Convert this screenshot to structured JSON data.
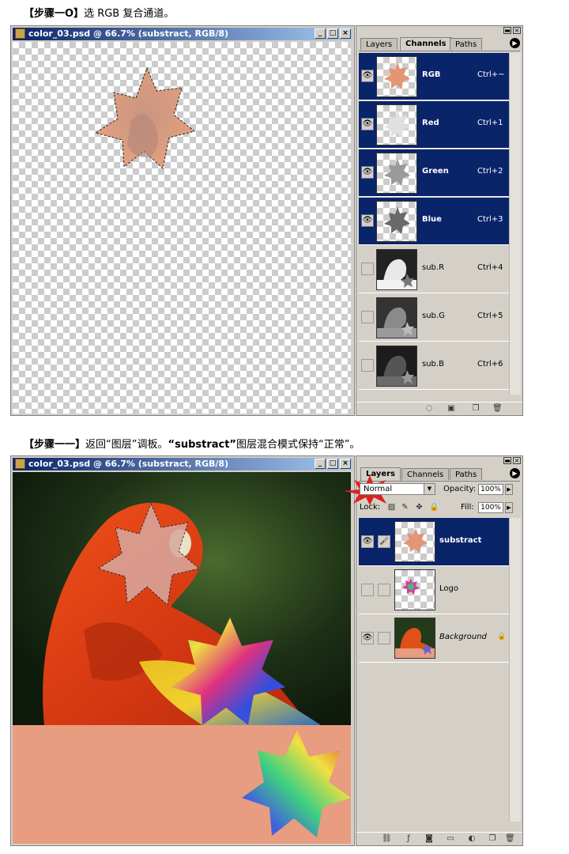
{
  "step10": {
    "caption_bracket": "【步骤一O】",
    "caption_text": "选 RGB 复合通道。"
  },
  "step11": {
    "caption_bracket": "【步骤一一】",
    "caption_text_1": "返回",
    "caption_quote_1": "“图层”",
    "caption_text_2": "调板。",
    "caption_quote_2": "“substract”",
    "caption_text_3": "图层混合模式保持",
    "caption_quote_3": "“正常”",
    "caption_text_4": "。"
  },
  "window1": {
    "title": "color_03.psd @ 66.7% (substract, RGB/8)"
  },
  "window2": {
    "title": "color_03.psd @ 66.7% (substract, RGB/8)"
  },
  "window_buttons": {
    "minimize": "_",
    "maximize": "□",
    "close": "×"
  },
  "channels_palette": {
    "tabs": [
      "Layers",
      "Channels",
      "Paths"
    ],
    "active_tab": "Channels",
    "channels": [
      {
        "name": "RGB",
        "shortcut": "Ctrl+~",
        "visible": true,
        "selected": true,
        "icon": "star-color-thumb"
      },
      {
        "name": "Red",
        "shortcut": "Ctrl+1",
        "visible": true,
        "selected": true,
        "icon": "star-light-thumb"
      },
      {
        "name": "Green",
        "shortcut": "Ctrl+2",
        "visible": true,
        "selected": true,
        "icon": "star-gray-thumb"
      },
      {
        "name": "Blue",
        "shortcut": "Ctrl+3",
        "visible": true,
        "selected": true,
        "icon": "star-dark-thumb"
      },
      {
        "name": "sub.R",
        "shortcut": "Ctrl+4",
        "visible": false,
        "selected": false,
        "icon": "parrot-gray-thumb"
      },
      {
        "name": "sub.G",
        "shortcut": "Ctrl+5",
        "visible": false,
        "selected": false,
        "icon": "parrot-gray-thumb"
      },
      {
        "name": "sub.B",
        "shortcut": "Ctrl+6",
        "visible": false,
        "selected": false,
        "icon": "parrot-dark-thumb"
      }
    ],
    "bottom_icons": [
      "load-selection-icon",
      "save-selection-icon",
      "new-channel-icon",
      "trash-icon"
    ]
  },
  "layers_palette": {
    "tabs": [
      "Layers",
      "Channels",
      "Paths"
    ],
    "active_tab": "Layers",
    "blend_mode": "Normal",
    "opacity_label": "Opacity:",
    "opacity_value": "100%",
    "fill_label": "Fill:",
    "fill_value": "100%",
    "lock_label": "Lock:",
    "layers": [
      {
        "name": "substract",
        "visible": true,
        "selected": true,
        "italic": false,
        "icon": "star-color-thumb"
      },
      {
        "name": "Logo",
        "visible": false,
        "selected": false,
        "italic": false,
        "icon": "rainbow-star-thumb"
      },
      {
        "name": "Background",
        "visible": true,
        "selected": false,
        "italic": true,
        "icon": "parrot-thumb",
        "locked": true
      }
    ],
    "bottom_icons": [
      "link-icon",
      "layer-style-icon",
      "mask-icon",
      "folder-icon",
      "adjustment-icon",
      "new-layer-icon",
      "trash-icon"
    ]
  },
  "colors": {
    "title_bar": "#0a246a",
    "selection": "#0a246a",
    "panel_bg": "#d4d0c8",
    "salmon_fill": "#e89c80",
    "highlight_burst": "#e02020"
  }
}
